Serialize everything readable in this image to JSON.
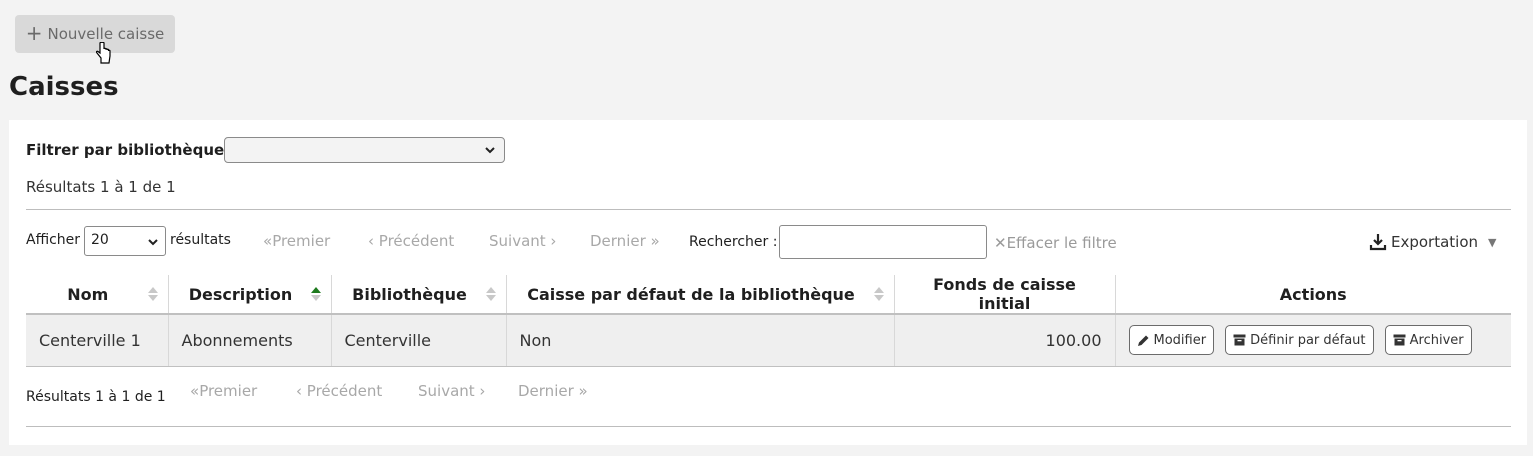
{
  "header": {
    "new_button_label": "Nouvelle caisse",
    "page_title": "Caisses"
  },
  "filter": {
    "label": "Filtrer par bibliothèque :",
    "selected": ""
  },
  "results_summary_top": "Résultats 1 à 1 de 1",
  "toolbar": {
    "show_label": "Afficher",
    "page_length": "20",
    "results_label": "résultats",
    "first": "Premier",
    "previous": "Précédent",
    "next": "Suivant",
    "last": "Dernier",
    "search_label": "Rechercher :",
    "search_value": "",
    "clear_filter": "Effacer le filtre",
    "export": "Exportation"
  },
  "table": {
    "columns": [
      "Nom",
      "Description",
      "Bibliothèque",
      "Caisse par défaut de la bibliothèque",
      "Fonds de caisse initial",
      "Actions"
    ],
    "rows": [
      {
        "name": "Centerville 1",
        "description": "Abonnements",
        "library": "Centerville",
        "default": "Non",
        "float": "100.00",
        "actions": [
          "Modifier",
          "Définir par défaut",
          "Archiver"
        ]
      }
    ]
  },
  "bottom": {
    "summary": "Résultats 1 à 1 de 1",
    "first": "Premier",
    "previous": "Précédent",
    "next": "Suivant",
    "last": "Dernier"
  },
  "colors": {
    "background": "#f3f3f3",
    "panel": "#ffffff",
    "sort_active": "#1e7a1e",
    "disabled_text": "#a8a8a8"
  }
}
